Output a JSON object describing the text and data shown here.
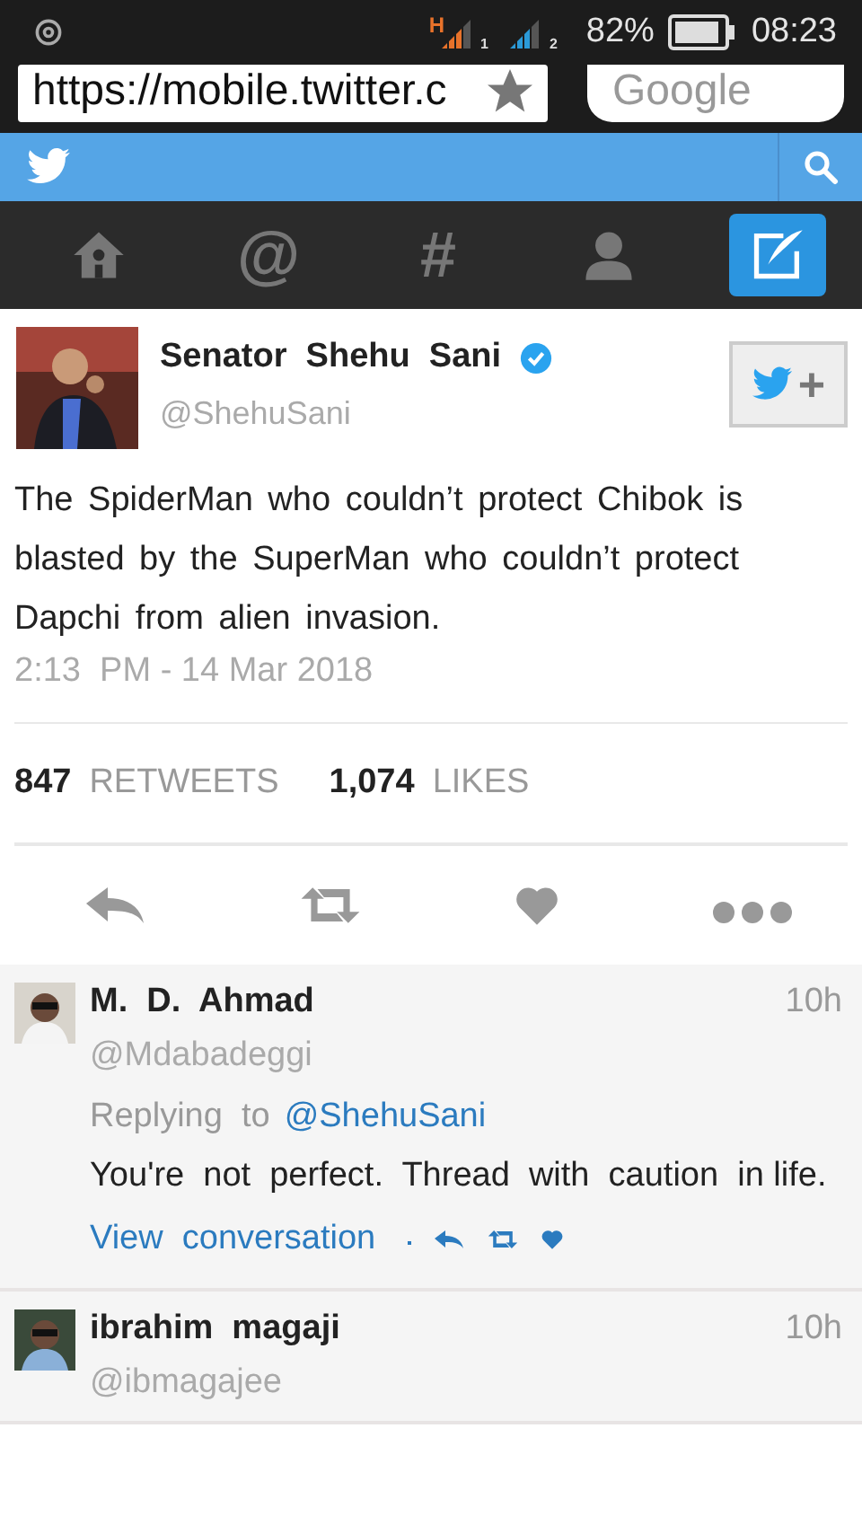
{
  "status_bar": {
    "network_type": "H",
    "sim_1": "1",
    "sim_2": "2",
    "battery": "82%",
    "time": "08:23"
  },
  "browser": {
    "url": "https://mobile.twitter.c",
    "search_placeholder": "Google"
  },
  "nav_tabs": [
    {
      "kind": "home",
      "selected": false
    },
    {
      "kind": "glyph",
      "label": "@",
      "selected": false
    },
    {
      "kind": "glyph",
      "label": "#",
      "selected": false
    },
    {
      "kind": "profile",
      "selected": false
    },
    {
      "kind": "compose",
      "selected": true
    }
  ],
  "tweet": {
    "author": "Senator  Shehu  Sani",
    "verified": true,
    "handle": "@ShehuSani",
    "follow_label": "+",
    "text": "The SpiderMan who couldn’t protect Chibok is blasted by the SuperMan who couldn’t protect Dapchi from alien invasion.",
    "timestamp": "2:13  PM - 14 Mar 2018",
    "retweets_count": "847",
    "retweets_label": "RETWEETS",
    "likes_count": "1,074",
    "likes_label": "LIKES"
  },
  "replies": [
    {
      "name": "M.  D.  Ahmad",
      "handle": "@Mdabadeggi",
      "time": "10h",
      "replying_label": "Replying  to",
      "replying_to": "@ShehuSani",
      "text": "You're  not  perfect.  Thread  with  caution  in life.",
      "link": "View  conversation"
    },
    {
      "name": "ibrahim  magaji",
      "handle": "@ibmagajee",
      "time": "10h"
    }
  ]
}
